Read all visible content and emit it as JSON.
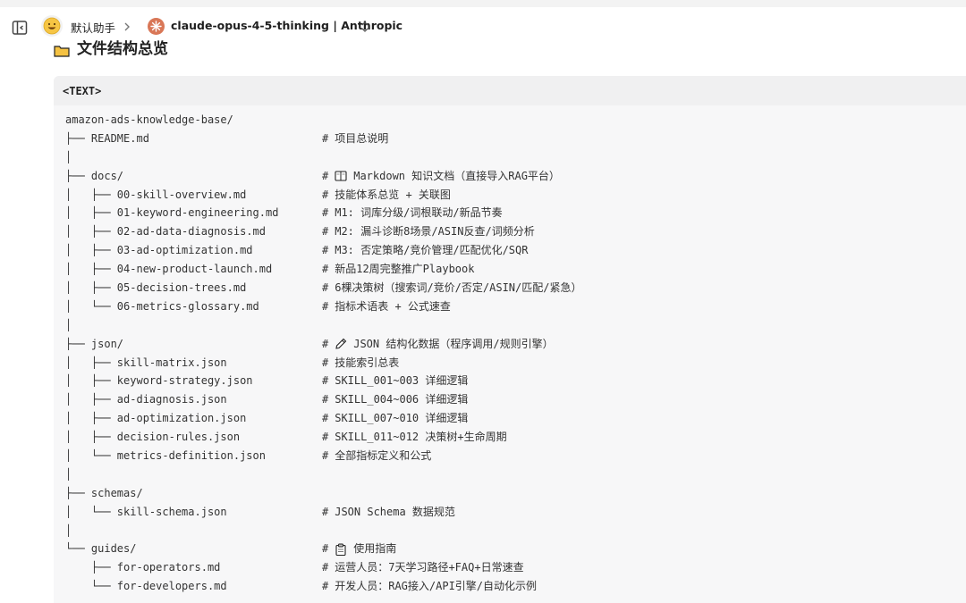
{
  "header": {
    "assistant_name": "默认助手",
    "model_name": "claude-opus-4-5-thinking | Anthropic"
  },
  "section": {
    "title": "文件结构总览"
  },
  "code": {
    "language": "<TEXT>",
    "lines": [
      {
        "path": "amazon-ads-knowledge-base/",
        "comment": null
      },
      {
        "path": "├── README.md",
        "comment": "项目总说明"
      },
      {
        "path": "│",
        "comment": null
      },
      {
        "path": "├── docs/",
        "comment": "Markdown 知识文档（直接导入RAG平台）",
        "icon": "book-icon"
      },
      {
        "path": "│   ├── 00-skill-overview.md",
        "comment": "技能体系总览 + 关联图"
      },
      {
        "path": "│   ├── 01-keyword-engineering.md",
        "comment": "M1: 词库分级/词根联动/新品节奏"
      },
      {
        "path": "│   ├── 02-ad-data-diagnosis.md",
        "comment": "M2: 漏斗诊断8场景/ASIN反查/词频分析"
      },
      {
        "path": "│   ├── 03-ad-optimization.md",
        "comment": "M3: 否定策略/竞价管理/匹配优化/SQR"
      },
      {
        "path": "│   ├── 04-new-product-launch.md",
        "comment": "新品12周完整推广Playbook"
      },
      {
        "path": "│   ├── 05-decision-trees.md",
        "comment": "6棵决策树（搜索词/竞价/否定/ASIN/匹配/紧急）"
      },
      {
        "path": "│   └── 06-metrics-glossary.md",
        "comment": "指标术语表 + 公式速查"
      },
      {
        "path": "│",
        "comment": null
      },
      {
        "path": "├── json/",
        "comment": "JSON 结构化数据（程序调用/规则引擎）",
        "icon": "pencil-icon"
      },
      {
        "path": "│   ├── skill-matrix.json",
        "comment": "技能索引总表"
      },
      {
        "path": "│   ├── keyword-strategy.json",
        "comment": "SKILL_001~003 详细逻辑"
      },
      {
        "path": "│   ├── ad-diagnosis.json",
        "comment": "SKILL_004~006 详细逻辑"
      },
      {
        "path": "│   ├── ad-optimization.json",
        "comment": "SKILL_007~010 详细逻辑"
      },
      {
        "path": "│   ├── decision-rules.json",
        "comment": "SKILL_011~012 决策树+生命周期"
      },
      {
        "path": "│   └── metrics-definition.json",
        "comment": "全部指标定义和公式"
      },
      {
        "path": "│",
        "comment": null
      },
      {
        "path": "├── schemas/",
        "comment": null
      },
      {
        "path": "│   └── skill-schema.json",
        "comment": "JSON Schema 数据规范"
      },
      {
        "path": "│",
        "comment": null
      },
      {
        "path": "└── guides/",
        "comment": "使用指南",
        "icon": "clipboard-icon"
      },
      {
        "path": "    ├── for-operators.md",
        "comment": "运营人员：7天学习路径+FAQ+日常速查"
      },
      {
        "path": "    └── for-developers.md",
        "comment": "开发人员：RAG接入/API引擎/自动化示例"
      }
    ]
  },
  "colors": {
    "model_accent": "#d97757",
    "folder_yellow": "#f5c242",
    "code_bg": "#f7f7f8",
    "code_header_bg": "#f0f0f1"
  }
}
